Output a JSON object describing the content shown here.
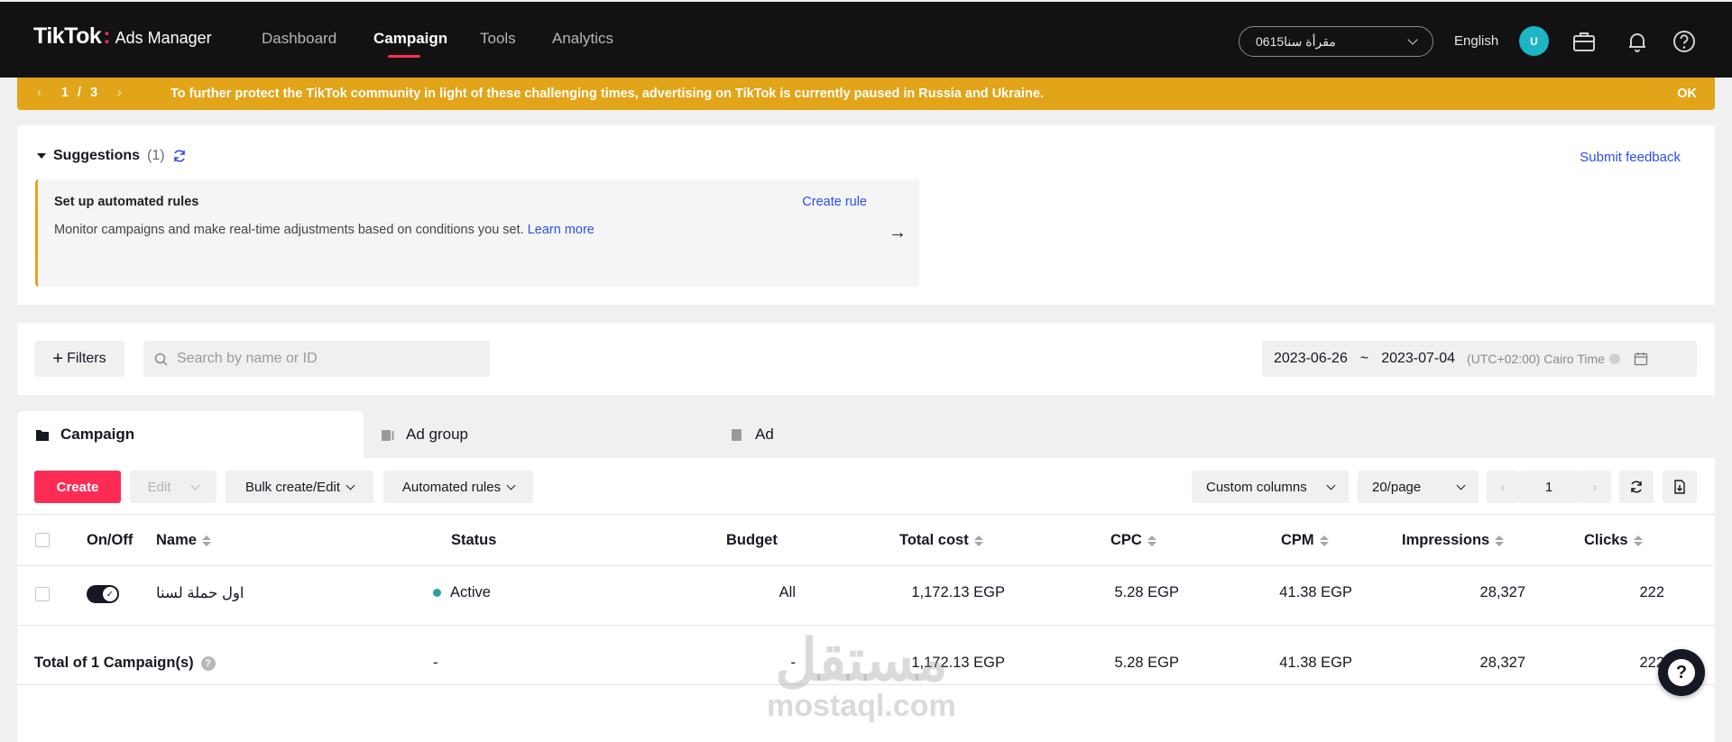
{
  "header": {
    "logo_brand": "TikTok",
    "logo_colon": ":",
    "logo_product": "Ads Manager",
    "nav": [
      {
        "label": "Dashboard"
      },
      {
        "label": "Campaign"
      },
      {
        "label": "Tools"
      },
      {
        "label": "Analytics"
      }
    ],
    "account_selector": "مقرأة سنا0615",
    "language": "English",
    "avatar_initial": "U",
    "icons": [
      "briefcase-icon",
      "bell-icon",
      "help-circle-icon"
    ]
  },
  "banner": {
    "page_current": "1",
    "page_sep": "/",
    "page_total": "3",
    "prev": "‹",
    "next": "›",
    "message": "To further protect the TikTok community in light of these challenging times, advertising on TikTok is currently paused in Russia and Ukraine.",
    "ok": "OK",
    "color": "#e2a418"
  },
  "suggestions": {
    "title": "Suggestions",
    "count": "(1)",
    "feedback": "Submit feedback",
    "card_title": "Set up automated rules",
    "card_action": "Create rule",
    "card_desc": "Monitor campaigns and make real-time adjustments based on conditions you set.",
    "card_link": "Learn more",
    "next_arrow": "→"
  },
  "filters": {
    "filters_label": "Filters",
    "search_placeholder": "Search by name or ID",
    "date_start": "2023-06-26",
    "date_sep": "~",
    "date_end": "2023-07-04",
    "timezone": "(UTC+02:00) Cairo Time"
  },
  "tabs": [
    {
      "label": "Campaign"
    },
    {
      "label": "Ad group"
    },
    {
      "label": "Ad"
    }
  ],
  "toolbar": {
    "create": "Create",
    "edit": "Edit",
    "bulk": "Bulk create/Edit",
    "automated_rules": "Automated rules",
    "custom_columns": "Custom columns",
    "page_size": "20/page",
    "page_number": "1",
    "accent": "#fe2c55"
  },
  "table": {
    "columns": [
      "On/Off",
      "Name",
      "Status",
      "Budget",
      "Total cost",
      "CPC",
      "CPM",
      "Impressions",
      "Clicks"
    ],
    "rows": [
      {
        "name": "اول حملة لسنا",
        "status": "Active",
        "budget": "All",
        "total_cost": "1,172.13 EGP",
        "cpc": "5.28 EGP",
        "cpm": "41.38 EGP",
        "impressions": "28,327",
        "clicks": "222"
      }
    ],
    "total": {
      "label": "Total of 1 Campaign(s)",
      "status": "-",
      "budget": "-",
      "total_cost": "1,172.13 EGP",
      "cpc": "5.28 EGP",
      "cpm": "41.38 EGP",
      "impressions": "28,327",
      "clicks": "222"
    },
    "status_color": "#2aa39a"
  },
  "watermark": {
    "arabic": "مستقل",
    "latin": "mostaql.com"
  },
  "help_fab": "?"
}
